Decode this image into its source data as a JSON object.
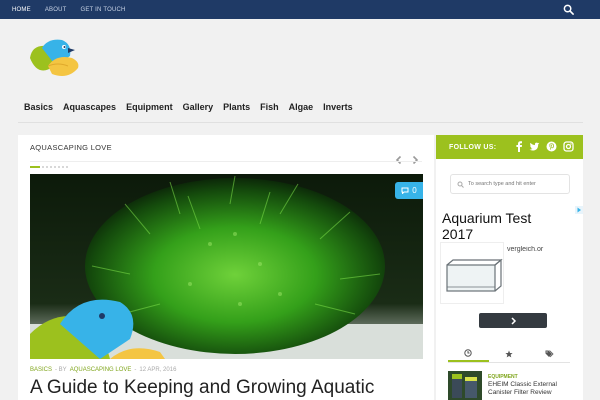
{
  "topbar": {
    "nav": [
      {
        "label": "HOME",
        "active": true
      },
      {
        "label": "ABOUT",
        "active": false
      },
      {
        "label": "GET IN TOUCH",
        "active": false
      }
    ],
    "search_icon": "search-icon",
    "bg_color": "#1f3a66"
  },
  "logo": {
    "icon": "bird-logo-icon",
    "colors": [
      "#9cc11e",
      "#37b3e8",
      "#f4c542"
    ]
  },
  "main_nav": {
    "items": [
      "Basics",
      "Aquascapes",
      "Equipment",
      "Gallery",
      "Plants",
      "Fish",
      "Algae",
      "Inverts"
    ]
  },
  "content": {
    "section_title": "AQUASCAPING LOVE",
    "slider": {
      "prev_icon": "chevron-left-icon",
      "next_icon": "chevron-right-icon"
    },
    "featured": {
      "comment_count": "0",
      "comment_icon": "comment-icon",
      "meta": {
        "category": "BASICS",
        "by_prefix": "- BY",
        "author": "AQUASCAPING LOVE",
        "date_prefix": "-",
        "date": "12 APR, 2016"
      },
      "title": "A Guide to Keeping and Growing Aquatic"
    }
  },
  "sidebar": {
    "follow_label": "FOLLOW US:",
    "social_icons": [
      "facebook-icon",
      "twitter-icon",
      "pinterest-icon",
      "instagram-icon"
    ],
    "search_placeholder": "To search type and hit enter",
    "ad": {
      "title": "Aquarium Test 2017",
      "store": "vergleich.or",
      "button_icon": "chevron-right-icon"
    },
    "tabs": [
      {
        "icon": "clock-icon",
        "active": true
      },
      {
        "icon": "star-icon",
        "active": false
      },
      {
        "icon": "tags-icon",
        "active": false
      }
    ],
    "popular": [
      {
        "category": "EQUIPMENT",
        "title": "EHEIM Classic External Canister Filter Review"
      }
    ],
    "accent_color": "#9cc11e"
  }
}
